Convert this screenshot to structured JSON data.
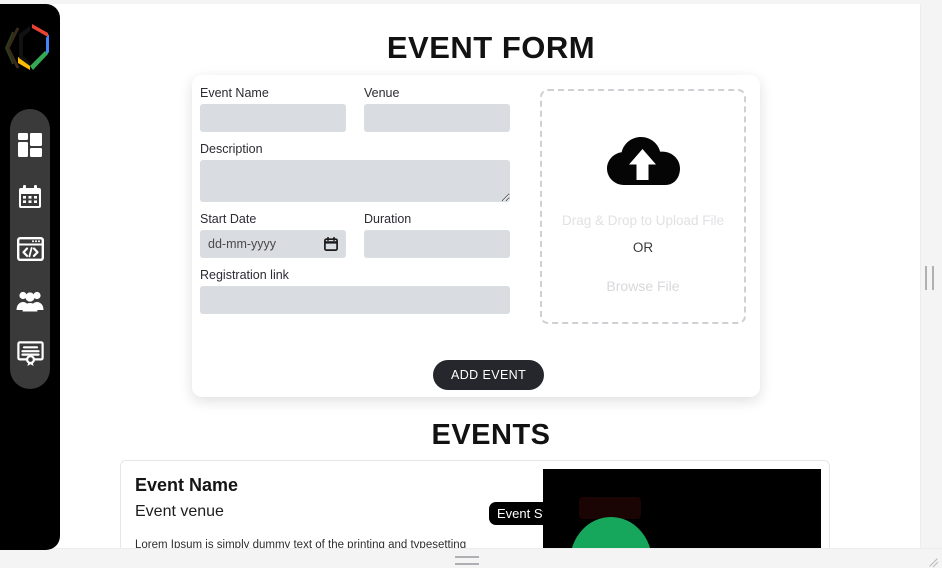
{
  "sidebar": {
    "logo_name": "gdg-hexagon-logo",
    "items": [
      {
        "icon": "dashboard-grid-icon",
        "label": "Dashboard"
      },
      {
        "icon": "calendar-icon",
        "label": "Events"
      },
      {
        "icon": "code-window-icon",
        "label": "Projects"
      },
      {
        "icon": "people-group-icon",
        "label": "Community"
      },
      {
        "icon": "certificate-icon",
        "label": "Certificates"
      }
    ]
  },
  "form": {
    "title": "EVENT FORM",
    "fields": {
      "event_name": {
        "label": "Event Name",
        "value": "",
        "placeholder": ""
      },
      "venue": {
        "label": "Venue",
        "value": "",
        "placeholder": ""
      },
      "description": {
        "label": "Description",
        "value": "",
        "placeholder": ""
      },
      "start_date": {
        "label": "Start Date",
        "value": "",
        "placeholder": "dd-mm-yyyy",
        "icon": "calendar-picker-icon"
      },
      "duration": {
        "label": "Duration",
        "value": "",
        "placeholder": ""
      },
      "registration_link": {
        "label": "Registration link",
        "value": "",
        "placeholder": ""
      }
    },
    "upload": {
      "icon": "cloud-upload-icon",
      "hint": "Drag & Drop to Upload File",
      "or": "OR",
      "browse": "Browse File"
    },
    "submit_label": "ADD EVENT"
  },
  "events": {
    "title": "EVENTS",
    "cards": [
      {
        "name": "Event Name",
        "venue": "Event venue",
        "status": "Event Status",
        "description": "Lorem Ipsum is simply dummy text of the printing and typesetting",
        "thumbnail": "black-poster-with-green-dome"
      }
    ]
  },
  "colors": {
    "sidebar_bg": "#000000",
    "rail_bg": "#3a3a3a",
    "field_bg": "#d9dce0",
    "button_bg": "#25272c",
    "accent_green": "#16a75c",
    "text_dark": "#121212"
  }
}
